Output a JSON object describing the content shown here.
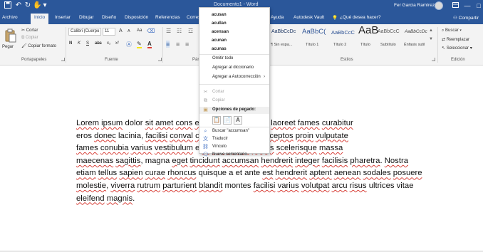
{
  "titlebar": {
    "title": "Documento1 - Word",
    "user": "Fer Garcia Ramírez",
    "save_icon": "save-icon",
    "undo_icon": "undo-icon",
    "redo_icon": "redo-icon",
    "touch_icon": "touch-mode-icon",
    "qat_more": "▾",
    "minimize": "—",
    "maximize": "□"
  },
  "tabs": [
    {
      "label": "Archivo"
    },
    {
      "label": "Inicio"
    },
    {
      "label": "Insertar"
    },
    {
      "label": "Dibujar"
    },
    {
      "label": "Diseño"
    },
    {
      "label": "Disposición"
    },
    {
      "label": "Referencias"
    },
    {
      "label": "Corres"
    },
    {
      "label": "Ayuda"
    },
    {
      "label": "Autodesk Vault"
    },
    {
      "label": "¿Qué desea hacer?"
    }
  ],
  "share": "Compartir",
  "ribbon": {
    "clipboard": {
      "paste": "Pegar",
      "cut": "Cortar",
      "copy": "Copiar",
      "format_painter": "Copiar formato",
      "label": "Portapapeles"
    },
    "font": {
      "font_name": "Calibri (Cuerpo",
      "font_size": "11",
      "grow": "A",
      "shrink": "A",
      "case": "Aa",
      "bold": "N",
      "italic": "K",
      "underline": "S",
      "strike": "abc",
      "sub": "x₂",
      "sup": "x²",
      "label": "Fuente"
    },
    "paragraph": {
      "label": "Párrafo"
    },
    "styles": {
      "items": [
        {
          "sample": "AaBbCcDc",
          "name": "¶ Sin espa..."
        },
        {
          "sample": "AaBbC(",
          "name": "Título 1"
        },
        {
          "sample": "AaBbCcC",
          "name": "Título 2"
        },
        {
          "sample": "AaB",
          "name": "Título"
        },
        {
          "sample": "AaBbCcC",
          "name": "Subtítulo"
        },
        {
          "sample": "AaBbCcDc",
          "name": "Énfasis sutil"
        }
      ],
      "label": "Estilos"
    },
    "editing": {
      "find": "Buscar",
      "replace": "Reemplazar",
      "select": "Seleccionar",
      "label": "Edición"
    }
  },
  "context_menu": {
    "suggestions": [
      "acusan",
      "acullan",
      "acensan",
      "acunan",
      "acunas"
    ],
    "items": [
      {
        "label": "Omitir todo",
        "disabled": false
      },
      {
        "label": "Agregar al diccionario",
        "disabled": false
      },
      {
        "label": "Agregar a Autocorrección",
        "disabled": false
      },
      {
        "label": "Cortar",
        "disabled": true
      },
      {
        "label": "Copiar",
        "disabled": true
      },
      {
        "label": "Opciones de pegado:",
        "disabled": false
      },
      {
        "label": "Buscar \"accumsan\"",
        "disabled": false
      },
      {
        "label": "Traducir",
        "disabled": false
      },
      {
        "label": "Vínculo",
        "disabled": false
      },
      {
        "label": "Nuevo comentario",
        "disabled": false
      }
    ]
  },
  "document": {
    "lines": [
      [
        {
          "t": "Lorem",
          "e": 1
        },
        {
          "t": " "
        },
        {
          "t": "ipsum",
          "e": 1
        },
        {
          "t": " dolor "
        },
        {
          "t": "sit",
          "e": 1
        },
        {
          "t": " "
        },
        {
          "t": "amet",
          "e": 1
        },
        {
          "t": " "
        },
        {
          "t": "cons",
          "e": 1
        },
        {
          "t": "                         "
        },
        {
          "t": "elit,",
          "e": 1
        },
        {
          "t": " "
        },
        {
          "t": "placerat",
          "e": 1
        },
        {
          "t": " pulvinar "
        },
        {
          "t": "laoreet",
          "e": 1
        },
        {
          "t": " "
        },
        {
          "t": "fames",
          "e": 1
        },
        {
          "t": " "
        },
        {
          "t": "curabitur",
          "e": 1
        }
      ],
      [
        {
          "t": "eros "
        },
        {
          "t": "donec",
          "e": 1
        },
        {
          "t": " lacinia, "
        },
        {
          "t": "facilisi",
          "e": 1
        },
        {
          "t": " "
        },
        {
          "t": "conval",
          "e": 1
        },
        {
          "t": "                        "
        },
        {
          "t": "ceptos",
          "e": 1
        },
        {
          "t": " per. "
        },
        {
          "t": "Aliquet",
          "e": 1
        },
        {
          "t": " "
        },
        {
          "t": "inceptos",
          "e": 1
        },
        {
          "t": " "
        },
        {
          "t": "proin",
          "e": 1
        },
        {
          "t": " "
        },
        {
          "t": "vulputate",
          "e": 1
        }
      ],
      [
        {
          "t": "fames",
          "e": 1
        },
        {
          "t": " "
        },
        {
          "t": "conubia",
          "e": 1
        },
        {
          "t": " "
        },
        {
          "t": "varius",
          "e": 1
        },
        {
          "t": " "
        },
        {
          "t": "vestibulum",
          "e": 1
        },
        {
          "t": "                  "
        },
        {
          "t": "e "
        },
        {
          "t": "cubilia",
          "e": 1
        },
        {
          "t": " "
        },
        {
          "t": "lobortis",
          "e": 1
        },
        {
          "t": " "
        },
        {
          "t": "lacus",
          "e": 1
        },
        {
          "t": " "
        },
        {
          "t": "scelerisque",
          "e": 1
        },
        {
          "t": " "
        },
        {
          "t": "massa",
          "e": 1
        }
      ],
      [
        {
          "t": "maecenas",
          "e": 1
        },
        {
          "t": " "
        },
        {
          "t": "sagittis",
          "e": 1
        },
        {
          "t": ", magna "
        },
        {
          "t": "eget",
          "e": 1
        },
        {
          "t": " "
        },
        {
          "t": "tincidunt",
          "e": 1
        },
        {
          "t": " "
        },
        {
          "t": "accumsan",
          "e": 1
        },
        {
          "t": " "
        },
        {
          "t": "hendrerit",
          "e": 1
        },
        {
          "t": " "
        },
        {
          "t": "integer",
          "e": 1
        },
        {
          "t": " "
        },
        {
          "t": "facilisis",
          "e": 1
        },
        {
          "t": " "
        },
        {
          "t": "pharetra",
          "e": 1
        },
        {
          "t": ". "
        },
        {
          "t": "Nostra",
          "e": 1
        }
      ],
      [
        {
          "t": "etiam",
          "e": 1
        },
        {
          "t": " "
        },
        {
          "t": "tellus",
          "e": 1
        },
        {
          "t": " "
        },
        {
          "t": "sapien",
          "e": 1
        },
        {
          "t": " "
        },
        {
          "t": "curae",
          "e": 1
        },
        {
          "t": " "
        },
        {
          "t": "rhoncus",
          "e": 1
        },
        {
          "t": " quisque a et ante "
        },
        {
          "t": "est",
          "e": 1
        },
        {
          "t": " "
        },
        {
          "t": "hendrerit",
          "e": 1
        },
        {
          "t": " "
        },
        {
          "t": "aptent",
          "e": 1
        },
        {
          "t": " "
        },
        {
          "t": "aenean",
          "e": 1
        },
        {
          "t": " "
        },
        {
          "t": "sodales",
          "e": 1
        },
        {
          "t": " "
        },
        {
          "t": "posuere",
          "e": 1
        }
      ],
      [
        {
          "t": "molestie",
          "e": 1
        },
        {
          "t": ", "
        },
        {
          "t": "viverra",
          "e": 1
        },
        {
          "t": " "
        },
        {
          "t": "rutrum",
          "e": 1
        },
        {
          "t": " "
        },
        {
          "t": "parturient",
          "e": 1
        },
        {
          "t": " "
        },
        {
          "t": "blandit",
          "e": 1
        },
        {
          "t": " montes "
        },
        {
          "t": "facilisi",
          "e": 1
        },
        {
          "t": " "
        },
        {
          "t": "varius",
          "e": 1
        },
        {
          "t": " "
        },
        {
          "t": "volutpat",
          "e": 1
        },
        {
          "t": " "
        },
        {
          "t": "arcu",
          "e": 1
        },
        {
          "t": " "
        },
        {
          "t": "risus",
          "e": 1
        },
        {
          "t": " ultrices vitae"
        }
      ],
      [
        {
          "t": "eleifend",
          "e": 1
        },
        {
          "t": " "
        },
        {
          "t": "magnis",
          "e": 1
        },
        {
          "t": "."
        }
      ]
    ]
  },
  "colors": {
    "accent": "#2b579a",
    "squiggle": "#d8413a"
  }
}
